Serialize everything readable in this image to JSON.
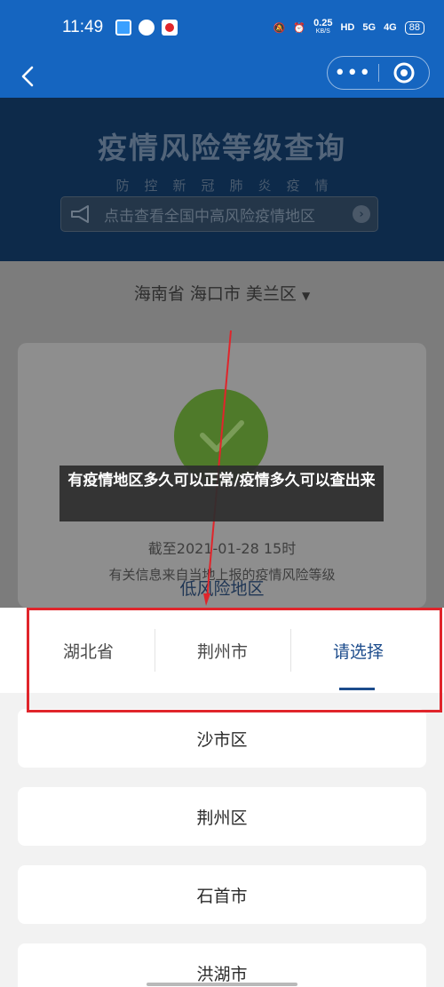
{
  "status": {
    "time": "11:49",
    "net_speed": "0.25",
    "net_unit": "KB/S",
    "hd": "HD",
    "signal1": "5G",
    "signal2": "4G",
    "battery": "88"
  },
  "banner": {
    "title": "疫情风险等级查询",
    "subtitle": "防控新冠肺炎疫情",
    "notice": "点击查看全国中高风险疫情地区"
  },
  "region": {
    "label": "海南省 海口市 美兰区"
  },
  "result": {
    "level": "低风险地区",
    "as_of": "截至2021-01-28 15时",
    "source": "有关信息来自当地上报的疫情风险等级"
  },
  "overlay": {
    "title": "有疫情地区多久可以正常/疫情多久可以查出来"
  },
  "picker": {
    "tabs": [
      "湖北省",
      "荆州市",
      "请选择"
    ],
    "items": [
      "沙市区",
      "荆州区",
      "石首市",
      "洪湖市"
    ]
  },
  "colors": {
    "header": "#1565c0",
    "banner": "#0d2a4a",
    "accent": "#1c4c8c",
    "annotation": "#e0252b"
  }
}
